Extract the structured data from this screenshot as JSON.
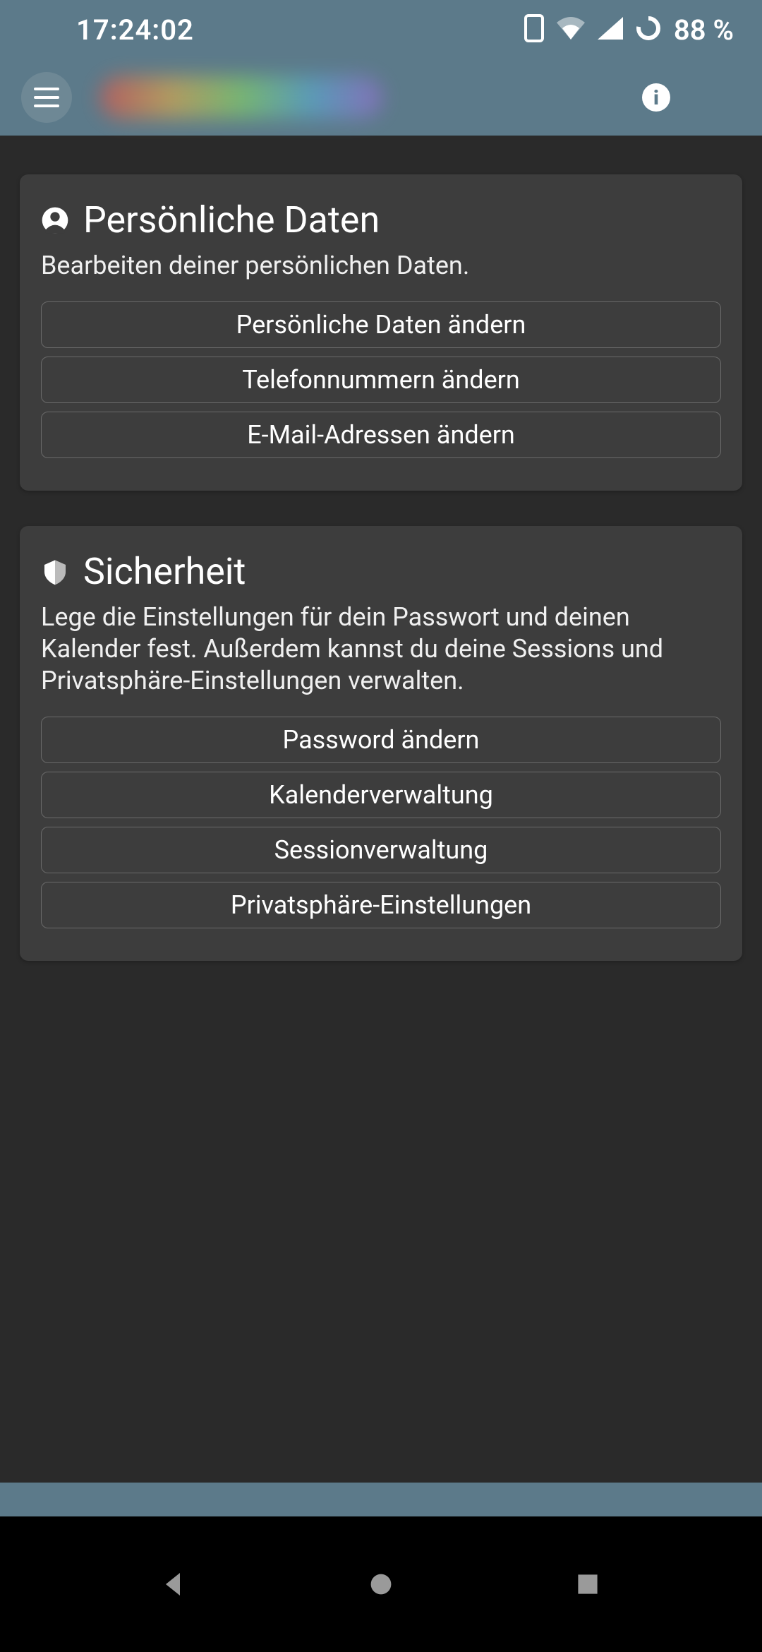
{
  "statusbar": {
    "time": "17:24:02",
    "battery": "88 %"
  },
  "sections": [
    {
      "title": "Persönliche Daten",
      "subtitle": "Bearbeiten deiner persönlichen Daten.",
      "buttons": [
        "Persönliche Daten ändern",
        "Telefonnummern ändern",
        "E-Mail-Adressen ändern"
      ]
    },
    {
      "title": "Sicherheit",
      "subtitle": "Lege die Einstellungen für dein Passwort und deinen Kalender fest. Außerdem kannst du deine Sessions und Privatsphäre-Einstellungen verwalten.",
      "buttons": [
        "Password ändern",
        "Kalenderverwaltung",
        "Sessionverwaltung",
        "Privatsphäre-Einstellungen"
      ]
    }
  ]
}
